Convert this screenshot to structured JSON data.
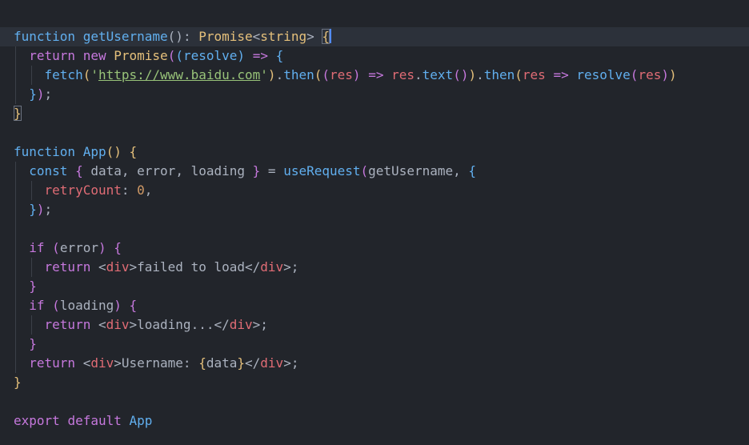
{
  "code": {
    "lines": [
      [
        [
          "fn",
          "function"
        ],
        [
          "pl",
          " "
        ],
        [
          "fn",
          "getUsername"
        ],
        [
          "pl",
          "(): "
        ],
        [
          "ty",
          "Promise"
        ],
        [
          "pl",
          "<"
        ],
        [
          "ty",
          "string"
        ],
        [
          "pl",
          "> "
        ],
        [
          "b1m",
          "{"
        ]
      ],
      [
        [
          "ws",
          "  "
        ],
        [
          "kw",
          "return"
        ],
        [
          "pl",
          " "
        ],
        [
          "kw",
          "new"
        ],
        [
          "pl",
          " "
        ],
        [
          "ty",
          "Promise"
        ],
        [
          "b2",
          "("
        ],
        [
          "b3",
          "("
        ],
        [
          "fn",
          "resolve"
        ],
        [
          "b3",
          ")"
        ],
        [
          "pl",
          " "
        ],
        [
          "op",
          "=>"
        ],
        [
          "pl",
          " "
        ],
        [
          "b3",
          "{"
        ]
      ],
      [
        [
          "ws",
          "    "
        ],
        [
          "fn",
          "fetch"
        ],
        [
          "b1",
          "("
        ],
        [
          "str",
          "'"
        ],
        [
          "strurl",
          "https://www.baidu.com"
        ],
        [
          "str",
          "'"
        ],
        [
          "b1",
          ")"
        ],
        [
          "pl",
          "."
        ],
        [
          "fn",
          "then"
        ],
        [
          "b1",
          "("
        ],
        [
          "b2",
          "("
        ],
        [
          "pm",
          "res"
        ],
        [
          "b2",
          ")"
        ],
        [
          "pl",
          " "
        ],
        [
          "op",
          "=>"
        ],
        [
          "pl",
          " "
        ],
        [
          "pm",
          "res"
        ],
        [
          "pl",
          "."
        ],
        [
          "fn",
          "text"
        ],
        [
          "b2",
          "()"
        ],
        [
          "b1",
          ")"
        ],
        [
          "pl",
          "."
        ],
        [
          "fn",
          "then"
        ],
        [
          "b1",
          "("
        ],
        [
          "pm",
          "res"
        ],
        [
          "pl",
          " "
        ],
        [
          "op",
          "=>"
        ],
        [
          "pl",
          " "
        ],
        [
          "fn",
          "resolve"
        ],
        [
          "b2",
          "("
        ],
        [
          "pm",
          "res"
        ],
        [
          "b2",
          ")"
        ],
        [
          "b1",
          ")"
        ]
      ],
      [
        [
          "ws",
          "  "
        ],
        [
          "b3",
          "}"
        ],
        [
          "b2",
          ")"
        ],
        [
          "pl",
          ";"
        ]
      ],
      [
        [
          "b1m",
          "}"
        ]
      ],
      [],
      [
        [
          "fn",
          "function"
        ],
        [
          "pl",
          " "
        ],
        [
          "fn",
          "App"
        ],
        [
          "b1",
          "()"
        ],
        [
          "pl",
          " "
        ],
        [
          "b1",
          "{"
        ]
      ],
      [
        [
          "ws",
          "  "
        ],
        [
          "fn",
          "const"
        ],
        [
          "pl",
          " "
        ],
        [
          "b2",
          "{"
        ],
        [
          "pl",
          " data, error, loading "
        ],
        [
          "b2",
          "}"
        ],
        [
          "pl",
          " = "
        ],
        [
          "fn",
          "useRequest"
        ],
        [
          "b2",
          "("
        ],
        [
          "pl",
          "getUsername, "
        ],
        [
          "b3",
          "{"
        ]
      ],
      [
        [
          "ws",
          "    "
        ],
        [
          "pm",
          "retryCount"
        ],
        [
          "pl",
          ": "
        ],
        [
          "num",
          "0"
        ],
        [
          "pl",
          ","
        ]
      ],
      [
        [
          "ws",
          "  "
        ],
        [
          "b3",
          "}"
        ],
        [
          "b2",
          ")"
        ],
        [
          "pl",
          ";"
        ]
      ],
      [],
      [
        [
          "ws",
          "  "
        ],
        [
          "kw",
          "if"
        ],
        [
          "pl",
          " "
        ],
        [
          "b2",
          "("
        ],
        [
          "pl",
          "error"
        ],
        [
          "b2",
          ")"
        ],
        [
          "pl",
          " "
        ],
        [
          "b2",
          "{"
        ]
      ],
      [
        [
          "ws",
          "    "
        ],
        [
          "kw",
          "return"
        ],
        [
          "pl",
          " <"
        ],
        [
          "tag",
          "div"
        ],
        [
          "pl",
          ">failed to load</"
        ],
        [
          "tag",
          "div"
        ],
        [
          "pl",
          ">;"
        ]
      ],
      [
        [
          "ws",
          "  "
        ],
        [
          "b2",
          "}"
        ]
      ],
      [
        [
          "ws",
          "  "
        ],
        [
          "kw",
          "if"
        ],
        [
          "pl",
          " "
        ],
        [
          "b2",
          "("
        ],
        [
          "pl",
          "loading"
        ],
        [
          "b2",
          ")"
        ],
        [
          "pl",
          " "
        ],
        [
          "b2",
          "{"
        ]
      ],
      [
        [
          "ws",
          "    "
        ],
        [
          "kw",
          "return"
        ],
        [
          "pl",
          " <"
        ],
        [
          "tag",
          "div"
        ],
        [
          "pl",
          ">loading...</"
        ],
        [
          "tag",
          "div"
        ],
        [
          "pl",
          ">;"
        ]
      ],
      [
        [
          "ws",
          "  "
        ],
        [
          "b2",
          "}"
        ]
      ],
      [
        [
          "ws",
          "  "
        ],
        [
          "kw",
          "return"
        ],
        [
          "pl",
          " <"
        ],
        [
          "tag",
          "div"
        ],
        [
          "pl",
          ">Username: "
        ],
        [
          "b1",
          "{"
        ],
        [
          "pl",
          "data"
        ],
        [
          "b1",
          "}"
        ],
        [
          "pl",
          "</"
        ],
        [
          "tag",
          "div"
        ],
        [
          "pl",
          ">;"
        ]
      ],
      [
        [
          "b1",
          "}"
        ]
      ],
      [],
      [
        [
          "kw",
          "export"
        ],
        [
          "pl",
          " "
        ],
        [
          "kw",
          "default"
        ],
        [
          "pl",
          " "
        ],
        [
          "fn",
          "App"
        ]
      ]
    ]
  },
  "guides": [
    [],
    [
      1
    ],
    [
      1,
      2
    ],
    [
      1
    ],
    [],
    [],
    [],
    [
      1
    ],
    [
      1,
      2
    ],
    [
      1
    ],
    [
      1
    ],
    [
      1
    ],
    [
      1,
      2
    ],
    [
      1
    ],
    [
      1
    ],
    [
      1,
      2
    ],
    [
      1
    ],
    [
      1
    ],
    [],
    [],
    []
  ],
  "colors": {
    "background": "#22252b",
    "current_line": "#2c313a",
    "keyword": "#c678dd",
    "function": "#61afef",
    "type": "#e5c07b",
    "string": "#98c379",
    "parameter": "#e06c75",
    "number": "#d19a66",
    "cursor": "#528bff"
  }
}
